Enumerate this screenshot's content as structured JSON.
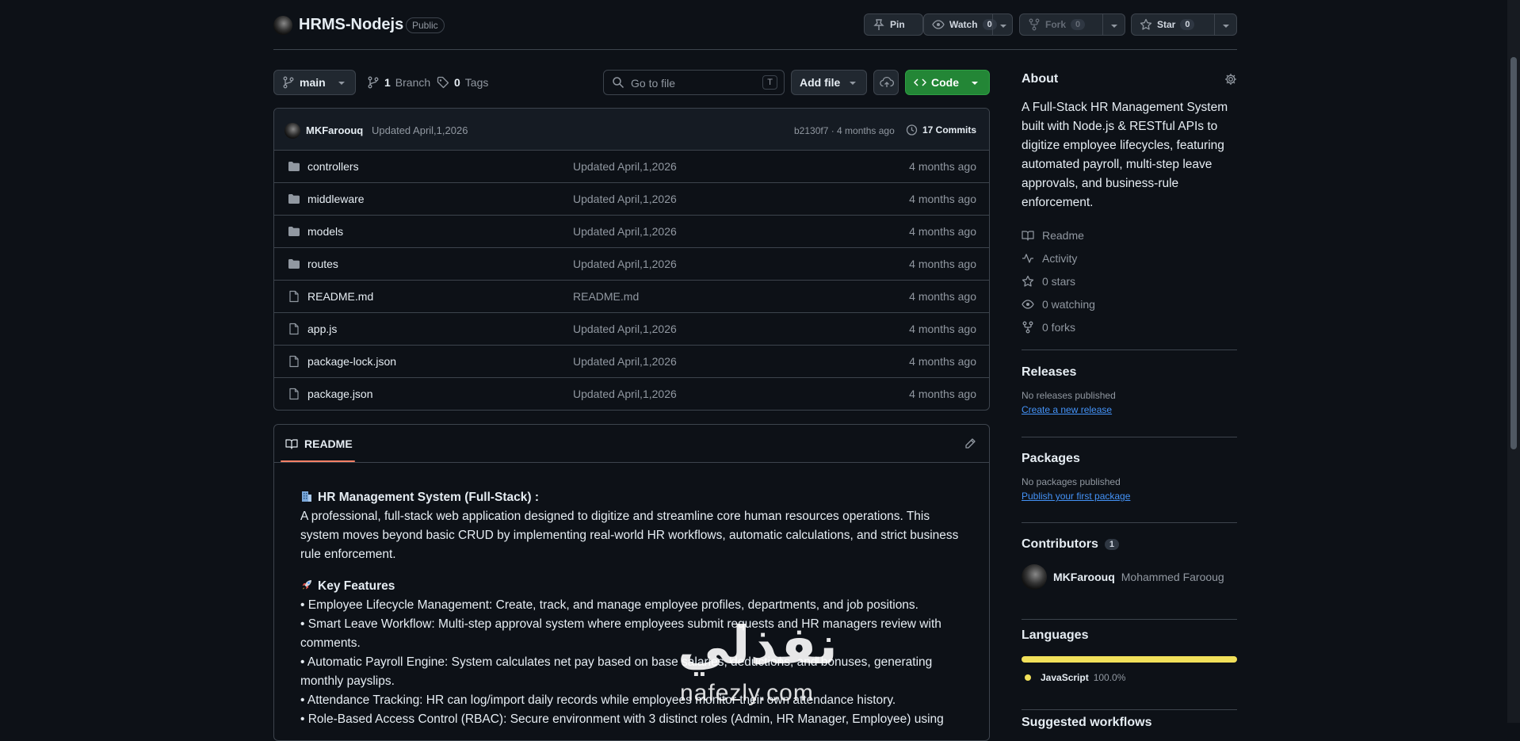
{
  "repo": {
    "name": "HRMS-Nodejs",
    "visibility": "Public"
  },
  "actions": {
    "pin_label": "Pin",
    "watch_label": "Watch",
    "watch_count": "0",
    "fork_label": "Fork",
    "fork_count": "0",
    "star_label": "Star",
    "star_count": "0"
  },
  "toolbar": {
    "branch": "main",
    "branches_count": "1",
    "branches_label": "Branch",
    "tags_count": "0",
    "tags_label": "Tags",
    "search_placeholder": "Go to file",
    "search_shortcut": "T",
    "add_file_label": "Add file",
    "code_label": "Code"
  },
  "commit": {
    "author": "MKFaroouq",
    "message": "Updated April,1,2026",
    "meta": "b2130f7 · 4 months ago",
    "commits_label": "17 Commits"
  },
  "files": [
    {
      "type": "folder",
      "name": "controllers",
      "message": "Updated April,1,2026",
      "age": "4 months ago"
    },
    {
      "type": "folder",
      "name": "middleware",
      "message": "Updated April,1,2026",
      "age": "4 months ago"
    },
    {
      "type": "folder",
      "name": "models",
      "message": "Updated April,1,2026",
      "age": "4 months ago"
    },
    {
      "type": "folder",
      "name": "routes",
      "message": "Updated April,1,2026",
      "age": "4 months ago"
    },
    {
      "type": "file",
      "name": "README.md",
      "message": "README.md",
      "age": "4 months ago"
    },
    {
      "type": "file",
      "name": "app.js",
      "message": "Updated April,1,2026",
      "age": "4 months ago"
    },
    {
      "type": "file",
      "name": "package-lock.json",
      "message": "Updated April,1,2026",
      "age": "4 months ago"
    },
    {
      "type": "file",
      "name": "package.json",
      "message": "Updated April,1,2026",
      "age": "4 months ago"
    }
  ],
  "readme": {
    "tab_label": "README",
    "title": "HR Management System (Full-Stack) :",
    "intro": "A professional, full-stack web application designed to digitize and streamline core human resources operations. This system moves beyond basic CRUD by implementing real-world HR workflows, automatic calculations, and strict business rule enforcement.",
    "features_title": "Key Features",
    "features": [
      "• Employee Lifecycle Management: Create, track, and manage employee profiles, departments, and job positions.",
      "• Smart Leave Workflow: Multi-step approval system where employees submit requests and HR managers review with comments.",
      "• Automatic Payroll Engine: System calculates net pay based on base salaries, deductions, and bonuses, generating monthly payslips.",
      "• Attendance Tracking: HR can log/import daily records while employees monitor their own attendance history.",
      "• Role-Based Access Control (RBAC): Secure environment with 3 distinct roles (Admin, HR Manager, Employee) using"
    ]
  },
  "about": {
    "heading": "About",
    "description": "A Full-Stack HR Management System built with Node.js & RESTful APIs to digitize employee lifecycles, featuring automated payroll, multi-step leave approvals, and business-rule enforcement.",
    "links": [
      {
        "icon": "book-icon",
        "label": "Readme"
      },
      {
        "icon": "pulse-icon",
        "label": "Activity"
      },
      {
        "icon": "star-icon",
        "label": "0 stars"
      },
      {
        "icon": "eye-icon",
        "label": "0 watching"
      },
      {
        "icon": "fork-icon",
        "label": "0 forks"
      }
    ]
  },
  "releases": {
    "heading": "Releases",
    "empty": "No releases published",
    "action": "Create a new release"
  },
  "packages": {
    "heading": "Packages",
    "empty": "No packages published",
    "action": "Publish your first package"
  },
  "contributors": {
    "heading": "Contributors",
    "count": "1",
    "login": "MKFaroouq",
    "fullname": "Mohammed Farooug"
  },
  "languages": {
    "heading": "Languages",
    "name": "JavaScript",
    "percent": "100.0%",
    "fraction": 1.0,
    "color": "#f1e05a"
  },
  "suggested": {
    "heading": "Suggested workflows"
  },
  "watermark": {
    "text": "nafezly.com"
  },
  "colors": {
    "code_button": "#238636",
    "link": "#4493f8",
    "readme_underline": "#f78166"
  }
}
